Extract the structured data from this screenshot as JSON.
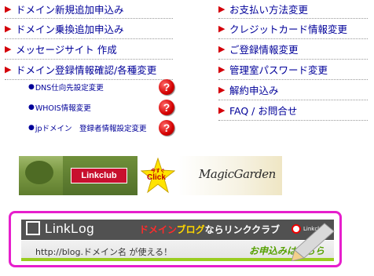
{
  "left_menu": [
    "ドメイン新規追加申込み",
    "ドメイン乗換追加申込み",
    "メッセージサイト 作成",
    "ドメイン登録情報確認/各種変更"
  ],
  "sub_menu": [
    "DNS仕向先設定変更",
    "WHOIS情報変更",
    "jpドメイン　登録者情報設定変更"
  ],
  "right_menu": [
    "お支払い方法変更",
    "クレジットカード情報変更",
    "ご登録情報変更",
    "管理室パスワード変更",
    "解約申込み",
    "FAQ / お問合せ"
  ],
  "help_glyph": "?",
  "banner1": {
    "logo": "Linkclub",
    "star_top": "今すぐ",
    "star_main": "Click",
    "brand": "MagicGarden"
  },
  "banner2": {
    "logo": "LinkLog",
    "tag_red": "ドメイン",
    "tag_yellow": "ブログ",
    "tag_rest": "ならリンククラブ",
    "badge": "Linkclub",
    "url_text": "http://blog.ドメイン名 が使える！",
    "cta": "お申込みはこちら"
  },
  "colors": {
    "arrow": "#d4000a",
    "link": "#000099",
    "frame": "#e61ecc",
    "accent_green": "#9acd20"
  }
}
